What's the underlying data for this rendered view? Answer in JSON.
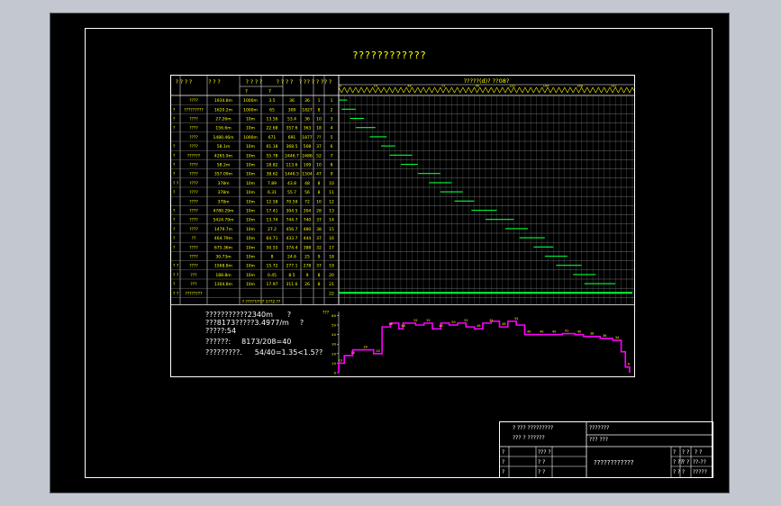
{
  "drawing": {
    "title": "????????????",
    "header_cols": [
      "? ? ? ?",
      "? ?  ?",
      "? ? ? ?",
      "? ? ? ?",
      "? ?",
      "? ? ? ?",
      "? ?"
    ],
    "header_sub": [
      "?",
      "?"
    ],
    "schedule_title": "?????(d)?   ??08?",
    "rows": [
      {
        "mark": "",
        "name": "????",
        "qty": "1934.8m",
        "unit": "1000m",
        "c1": "3.5",
        "c2": "36",
        "c3": "36",
        "c4": "1"
      },
      {
        "mark": "?",
        "name": "?????????",
        "qty": "1620.2m",
        "unit": "1000m",
        "c1": "65",
        "c2": "309",
        "c3": "1827",
        "c4": "8"
      },
      {
        "mark": "?",
        "name": "????",
        "qty": "27.26m",
        "unit": "10m",
        "c1": "13.56",
        "c2": "53.4",
        "c3": "36",
        "c4": "10"
      },
      {
        "mark": "?",
        "name": "????",
        "qty": "156.6m",
        "unit": "10m",
        "c1": "22.68",
        "c2": "357.6",
        "c3": "363",
        "c4": "18"
      },
      {
        "mark": "",
        "name": "????",
        "qty": "1480.46m",
        "unit": "1000m",
        "c1": "671",
        "c2": "691",
        "c3": "1877",
        "c4": "??"
      },
      {
        "mark": "?",
        "name": "????",
        "qty": "58.1m",
        "unit": "10m",
        "c1": "61.18",
        "c2": "368.5",
        "c3": "508",
        "c4": "37"
      },
      {
        "mark": "?",
        "name": "??????",
        "qty": "4265.9m",
        "unit": "10m",
        "c1": "55.78",
        "c2": "2446.7",
        "c3": "2486",
        "c4": "52"
      },
      {
        "mark": "?",
        "name": "????",
        "qty": "58.2m",
        "unit": "10m",
        "c1": "18.82",
        "c2": "113.6",
        "c3": "109",
        "c4": "10"
      },
      {
        "mark": "?",
        "name": "????",
        "qty": "357.09m",
        "unit": "10m",
        "c1": "38.62",
        "c2": "1446.5",
        "c3": "1504",
        "c4": "47"
      },
      {
        "mark": "? ?",
        "name": "????",
        "qty": "378m",
        "unit": "10m",
        "c1": "7.89",
        "c2": "43.8",
        "c3": "48",
        "c4": "8"
      },
      {
        "mark": "?",
        "name": "????",
        "qty": "378m",
        "unit": "10m",
        "c1": "6.31",
        "c2": "55.7",
        "c3": "56",
        "c4": "8"
      },
      {
        "mark": "",
        "name": "????",
        "qty": "378m",
        "unit": "10m",
        "c1": "12.58",
        "c2": "70.59",
        "c3": "72",
        "c4": "10"
      },
      {
        "mark": "?",
        "name": "????",
        "qty": "4780.29m",
        "unit": "10m",
        "c1": "17.41",
        "c2": "304.5",
        "c3": "304",
        "c4": "28"
      },
      {
        "mark": "?",
        "name": "????",
        "qty": "5424.79m",
        "unit": "10m",
        "c1": "13.74",
        "c2": "744.7",
        "c3": "740",
        "c4": "37"
      },
      {
        "mark": "?",
        "name": "????",
        "qty": "1479.7m",
        "unit": "10m",
        "c1": "27.2",
        "c2": "456.7",
        "c3": "480",
        "c4": "38"
      },
      {
        "mark": "?",
        "name": "??",
        "qty": "464.79m",
        "unit": "10m",
        "c1": "64.71",
        "c2": "433.7",
        "c3": "444",
        "c4": "37"
      },
      {
        "mark": "?",
        "name": "????",
        "qty": "675.36m",
        "unit": "10m",
        "c1": "50.55",
        "c2": "374.4",
        "c3": "388",
        "c4": "32"
      },
      {
        "mark": "",
        "name": "????",
        "qty": "30.73m",
        "unit": "10m",
        "c1": "8",
        "c2": "24.6",
        "c3": "25",
        "c4": "9"
      },
      {
        "mark": "? ?",
        "name": "????",
        "qty": "1568.8m",
        "unit": "10m",
        "c1": "15.72",
        "c2": "277.1",
        "c3": "278",
        "c4": "37"
      },
      {
        "mark": "? ?",
        "name": "???",
        "qty": "188.8m",
        "unit": "10m",
        "c1": "0.45",
        "c2": "8.5",
        "c3": "9",
        "c4": "8"
      },
      {
        "mark": "?",
        "name": "???",
        "qty": "1304.8m",
        "unit": "10m",
        "c1": "17.97",
        "c2": "311.6",
        "c3": "26",
        "c4": "8"
      },
      {
        "mark": "? ?",
        "name": "????????",
        "qty": "",
        "unit": "",
        "c1": "",
        "c2": "",
        "c3": "",
        "c4": ""
      }
    ],
    "total_row": "?.?????/??? 1??2.??",
    "notes": {
      "line1": "???????????2340m",
      "line1b": "?",
      "line2": "???8173?????3.4977/m",
      "line2b": "?",
      "line3": "?????:54",
      "line4a": "??????:",
      "line4b": "8173/208=40",
      "line5a": "?????????.",
      "line5b": "54/40=1.35<1.5??"
    },
    "histogram_axis_label": "???",
    "histogram_peak_label": "54",
    "title_block": {
      "school": "? ??? ?????????",
      "dept": "??? ? ??????",
      "c1": "?",
      "c2": "?",
      "c3": "?",
      "c4": "??? ?",
      "c5": "? ?",
      "c6": "? ?",
      "right_top": "???????",
      "right_second": "??? ???",
      "project": "????????????",
      "r1": "?",
      "r2": "? ?",
      "r3": "? ?",
      "r4": "? ??",
      "r5": "? ?",
      "r6": "??-??",
      "r7": "? ?",
      "r8": "?",
      "r9": "?????"
    }
  },
  "chart_data": {
    "type": "area",
    "title": "",
    "xlabel": "",
    "ylabel": "???",
    "ylim": [
      0,
      60
    ],
    "x": [
      1,
      4,
      7,
      10,
      13,
      16,
      19,
      22,
      25,
      28,
      31,
      34,
      37,
      40,
      43,
      46,
      49,
      52,
      55,
      58,
      61,
      64,
      67,
      70,
      73,
      76,
      79,
      82,
      85,
      88,
      91,
      94,
      97,
      100,
      103,
      106,
      109,
      112,
      115,
      118,
      121,
      124,
      127,
      130,
      133,
      136,
      139,
      142,
      145,
      148,
      151,
      154,
      157,
      160,
      163,
      166,
      169,
      172,
      175,
      178,
      181,
      184,
      187,
      190,
      193,
      196,
      199,
      202,
      205,
      208
    ],
    "values": [
      10,
      10,
      18,
      18,
      24,
      24,
      24,
      24,
      24,
      20,
      20,
      48,
      48,
      52,
      52,
      46,
      52,
      52,
      52,
      50,
      50,
      52,
      52,
      46,
      46,
      52,
      52,
      50,
      50,
      52,
      52,
      48,
      48,
      46,
      46,
      52,
      52,
      54,
      54,
      48,
      48,
      54,
      54,
      50,
      50,
      40,
      40,
      40,
      40,
      40,
      40,
      40,
      40,
      40,
      41,
      41,
      41,
      40,
      40,
      38,
      38,
      38,
      38,
      36,
      36,
      36,
      34,
      34,
      22,
      6
    ]
  }
}
